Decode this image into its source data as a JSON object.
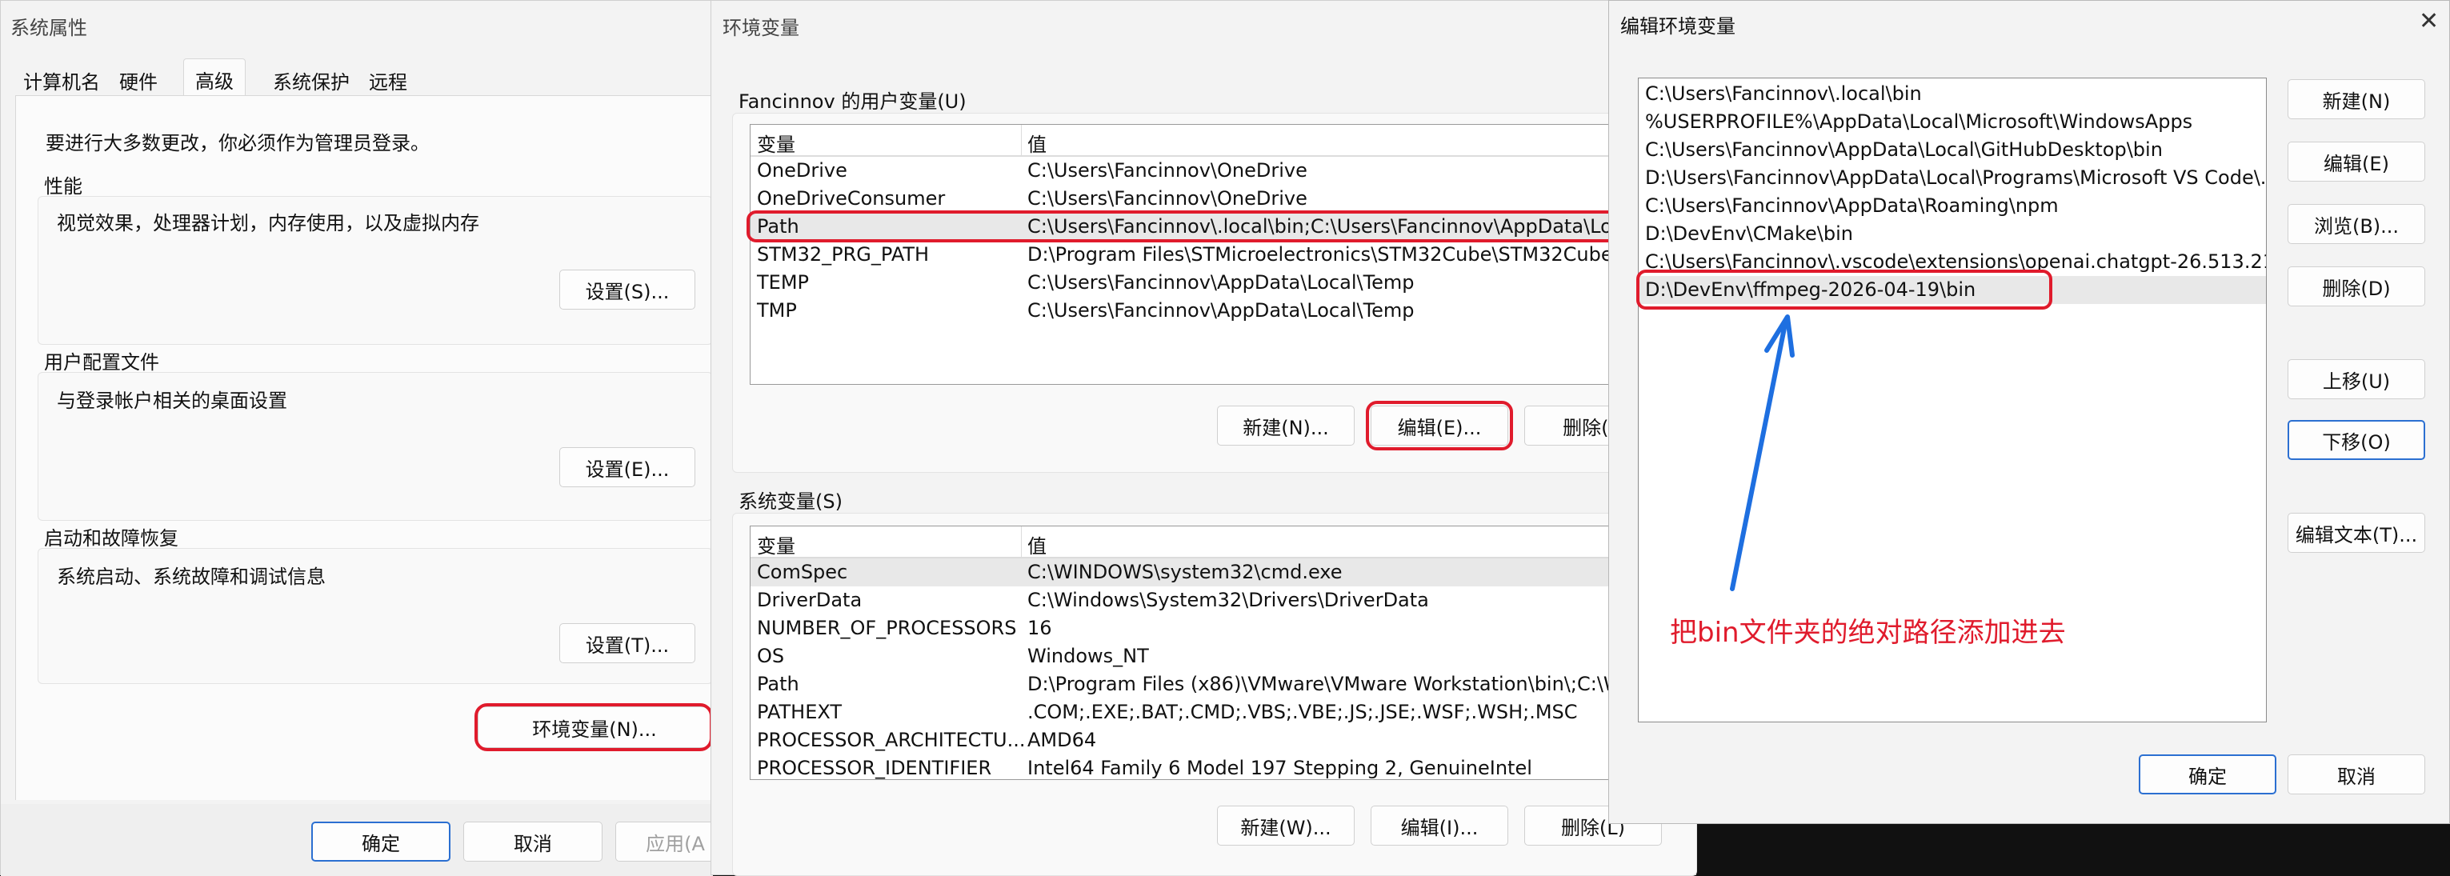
{
  "sys_props": {
    "title": "系统属性",
    "tabs": [
      "计算机名",
      "硬件",
      "高级",
      "系统保护",
      "远程"
    ],
    "admin_note": "要进行大多数更改，你必须作为管理员登录。",
    "perf": {
      "heading": "性能",
      "desc": "视觉效果，处理器计划，内存使用，以及虚拟内存",
      "btn": "设置(S)..."
    },
    "profile": {
      "heading": "用户配置文件",
      "desc": "与登录帐户相关的桌面设置",
      "btn": "设置(E)..."
    },
    "startup": {
      "heading": "启动和故障恢复",
      "desc": "系统启动、系统故障和调试信息",
      "btn": "设置(T)..."
    },
    "env_btn": "环境变量(N)...",
    "ok": "确定",
    "cancel": "取消",
    "apply": "应用(A"
  },
  "env_vars": {
    "title": "环境变量",
    "user_label": "Fancinnov 的用户变量(U)",
    "col_var": "变量",
    "col_val": "值",
    "user_rows": [
      {
        "name": "OneDrive",
        "value": "C:\\Users\\Fancinnov\\OneDrive"
      },
      {
        "name": "OneDriveConsumer",
        "value": "C:\\Users\\Fancinnov\\OneDrive"
      },
      {
        "name": "Path",
        "value": "C:\\Users\\Fancinnov\\.local\\bin;C:\\Users\\Fancinnov\\AppData\\Loc"
      },
      {
        "name": "STM32_PRG_PATH",
        "value": "D:\\Program Files\\STMicroelectronics\\STM32Cube\\STM32Cube..."
      },
      {
        "name": "TEMP",
        "value": "C:\\Users\\Fancinnov\\AppData\\Local\\Temp"
      },
      {
        "name": "TMP",
        "value": "C:\\Users\\Fancinnov\\AppData\\Local\\Temp"
      }
    ],
    "user_new": "新建(N)...",
    "user_edit": "编辑(E)...",
    "user_delete": "删除(D",
    "sys_label": "系统变量(S)",
    "sys_rows": [
      {
        "name": "ComSpec",
        "value": "C:\\WINDOWS\\system32\\cmd.exe"
      },
      {
        "name": "DriverData",
        "value": "C:\\Windows\\System32\\Drivers\\DriverData"
      },
      {
        "name": "NUMBER_OF_PROCESSORS",
        "value": "16"
      },
      {
        "name": "OS",
        "value": "Windows_NT"
      },
      {
        "name": "Path",
        "value": "D:\\Program Files (x86)\\VMware\\VMware Workstation\\bin\\;C:\\W..."
      },
      {
        "name": "PATHEXT",
        "value": ".COM;.EXE;.BAT;.CMD;.VBS;.VBE;.JS;.JSE;.WSF;.WSH;.MSC"
      },
      {
        "name": "PROCESSOR_ARCHITECTU...",
        "value": "AMD64"
      },
      {
        "name": "PROCESSOR_IDENTIFIER",
        "value": "Intel64 Family 6 Model 197 Stepping 2, GenuineIntel"
      }
    ],
    "sys_new": "新建(W)...",
    "sys_edit": "编辑(I)...",
    "sys_delete": "删除(L)"
  },
  "edit_env": {
    "title": "编辑环境变量",
    "close_glyph": "✕",
    "entries": [
      "C:\\Users\\Fancinnov\\.local\\bin",
      "%USERPROFILE%\\AppData\\Local\\Microsoft\\WindowsApps",
      "C:\\Users\\Fancinnov\\AppData\\Local\\GitHubDesktop\\bin",
      "D:\\Users\\Fancinnov\\AppData\\Local\\Programs\\Microsoft VS Code\\...",
      "C:\\Users\\Fancinnov\\AppData\\Roaming\\npm",
      "D:\\DevEnv\\CMake\\bin",
      "C:\\Users\\Fancinnov\\.vscode\\extensions\\openai.chatgpt-26.513.21...",
      "D:\\DevEnv\\ffmpeg-2026-04-19\\bin"
    ],
    "btn_new": "新建(N)",
    "btn_edit": "编辑(E)",
    "btn_browse": "浏览(B)...",
    "btn_delete": "删除(D)",
    "btn_up": "上移(U)",
    "btn_down": "下移(O)",
    "btn_edit_text": "编辑文本(T)...",
    "ok": "确定",
    "cancel": "取消"
  },
  "annotation": {
    "text": "把bin文件夹的绝对路径添加进去",
    "color": "#e01b2c",
    "arrow_color": "#1e6fe0"
  },
  "colors": {
    "highlight": "#e01b2c",
    "selected_row": "#e8e8e8",
    "accent": "#2b6fd1"
  }
}
